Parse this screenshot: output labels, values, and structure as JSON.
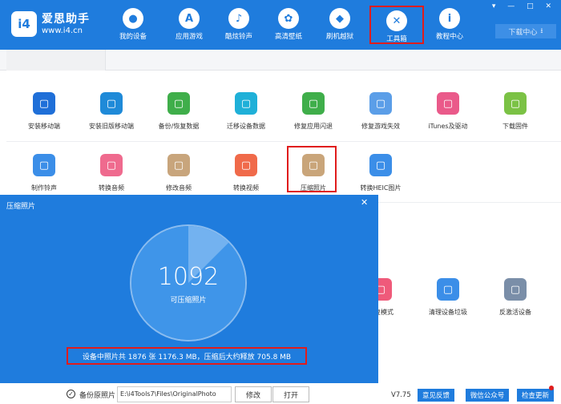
{
  "app": {
    "brand": "爱思助手",
    "url": "www.i4.cn",
    "logo": "i4",
    "window_controls": "▾ — □ ✕",
    "download_label": "下载中心"
  },
  "nav": [
    {
      "label": "我的设备",
      "icon": "apple-icon"
    },
    {
      "label": "应用游戏",
      "icon": "app-store-icon"
    },
    {
      "label": "酷炫铃声",
      "icon": "bell-icon"
    },
    {
      "label": "高清壁纸",
      "icon": "flower-icon"
    },
    {
      "label": "刷机越狱",
      "icon": "dropbox-icon"
    },
    {
      "label": "工具箱",
      "icon": "tools-icon",
      "selected": true
    },
    {
      "label": "教程中心",
      "icon": "info-icon"
    }
  ],
  "tools_row1": [
    {
      "label": "安装移动端",
      "color": "#1f6fd8"
    },
    {
      "label": "安装旧版移动端",
      "color": "#1f8ad8"
    },
    {
      "label": "备份/恢复数据",
      "color": "#3fae4a"
    },
    {
      "label": "迁移设备数据",
      "color": "#1fb0d8"
    },
    {
      "label": "修复应用闪退",
      "color": "#3fae4a"
    },
    {
      "label": "修复游戏失效",
      "color": "#5b9ee8"
    },
    {
      "label": "iTunes及驱动",
      "color": "#ea5a8a"
    },
    {
      "label": "下载固件",
      "color": "#7bc245"
    }
  ],
  "tools_row2": [
    {
      "label": "制作铃声",
      "color": "#3b8ee8"
    },
    {
      "label": "转换音频",
      "color": "#ef6a8e"
    },
    {
      "label": "修改音频",
      "color": "#c8a57c"
    },
    {
      "label": "转换视频",
      "color": "#f06a4a"
    },
    {
      "label": "压缩照片",
      "color": "#c9a57a"
    },
    {
      "label": "转换HEIC图片",
      "color": "#3b8ee8"
    }
  ],
  "tools_row3": [
    {
      "label": "恢复模式",
      "color": "#ef5a7a"
    },
    {
      "label": "清理设备垃圾",
      "color": "#3b8ee8"
    },
    {
      "label": "反激活设备",
      "color": "#7a8ea8"
    }
  ],
  "dialog": {
    "title": "压缩照片",
    "close": "✕",
    "count": "1092",
    "count_label": "可压缩照片",
    "info": "设备中照片共 1876 张 1176.3 MB，压缩后大约释放 705.8 MB",
    "backup_label": "备份原照片",
    "backup_checked": true,
    "path": "E:\\i4Tools7\\Files\\OriginalPhoto",
    "modify": "修改",
    "open": "打开"
  },
  "status": {
    "version": "V7.75",
    "feedback": "意见反馈",
    "wechat": "微信公众号",
    "update": "检查更新"
  }
}
